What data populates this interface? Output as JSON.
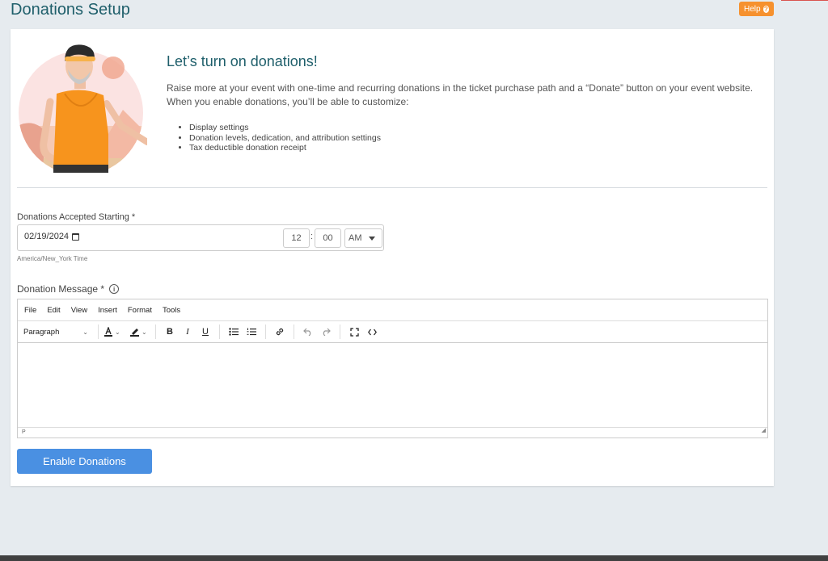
{
  "page": {
    "title": "Donations Setup",
    "help_label": "Help"
  },
  "hero": {
    "title": "Let’s turn on donations!",
    "description": "Raise more at your event with one-time and recurring donations in the ticket purchase path and a “Donate” button on your event website. When you enable donations, you’ll be able to customize:",
    "features": [
      "Display settings",
      "Donation levels, dedication, and attribution settings",
      "Tax deductible donation receipt"
    ]
  },
  "donation_start": {
    "label": "Donations Accepted Starting *",
    "date": "02/19/2024",
    "hour": "12",
    "minute": "00",
    "colon": ":",
    "ampm": "AM",
    "timezone": "America/New_York Time"
  },
  "message": {
    "label": "Donation Message *",
    "menu": [
      "File",
      "Edit",
      "View",
      "Insert",
      "Format",
      "Tools"
    ],
    "block_format": "Paragraph",
    "status_path": "P"
  },
  "actions": {
    "enable_label": "Enable Donations"
  },
  "colors": {
    "accent": "#4a90e2",
    "help": "#f6912e",
    "title": "#1f5f6b"
  }
}
